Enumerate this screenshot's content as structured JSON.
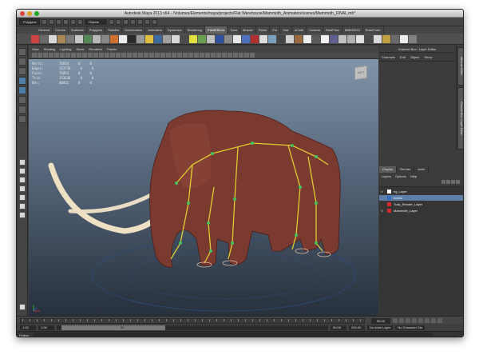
{
  "window": {
    "title": "Autodesk Maya 2013 x64 - /Volumes/Elements/maya/projects/Flat Warehouse/Mammoth_Animation/scenes/Mammoth_FINAL.mb*"
  },
  "statusline": {
    "menuset": "Polygons",
    "selection_field": "Objects"
  },
  "shelf": {
    "tabs": [
      "General",
      "Curves",
      "Surfaces",
      "Polygons",
      "Subdivs",
      "Deformation",
      "Animation",
      "Dynamics",
      "Rendering",
      "PaintEffects",
      "Toon",
      "Muscle",
      "Fluids",
      "Fur",
      "Hair",
      "nCloth",
      "Custom",
      "RealFlow",
      "MMM2013",
      "RoboForm"
    ],
    "active_tab": "PaintEffects",
    "icon_colors": [
      "#c44",
      "#6a6a6a",
      "#d8d8d8",
      "#aa8855",
      "#7a7a7a",
      "#c8c8c8",
      "#558855",
      "#b8b8b8",
      "#888",
      "#d07030",
      "#ececec",
      "#2a2a2a",
      "#999",
      "#e0c040",
      "#3a6aa0",
      "#a0a0a0",
      "#d8d8d8",
      "#4a4a4a",
      "#e0e040",
      "#6aa050",
      "#c0c0c0",
      "#3050a0",
      "#8a8a8a",
      "#e8e8e8",
      "#5070c0",
      "#b03030",
      "#ddd",
      "#7aa0c0",
      "#444",
      "#d0d0d0",
      "#9a6a40",
      "#eeeeee",
      "#5a5a5a",
      "#f0f0f0",
      "#606090",
      "#c0c0c0",
      "#b0b0b0",
      "#e0e0e0",
      "#4a4a4a",
      "#dadada",
      "#c0a040",
      "#6a6a6a",
      "#ececec",
      "#808080"
    ]
  },
  "panel": {
    "menu": [
      "View",
      "Shading",
      "Lighting",
      "Show",
      "Renderer",
      "Panels"
    ]
  },
  "hud": [
    {
      "label": "Verts:",
      "a": "76834",
      "b": "0",
      "c": "0"
    },
    {
      "label": "Edges:",
      "a": "153728",
      "b": "0",
      "c": "0"
    },
    {
      "label": "Faces:",
      "a": "76854",
      "b": "0",
      "c": "0"
    },
    {
      "label": "Tris:",
      "a": "153636",
      "b": "0",
      "c": "0"
    },
    {
      "label": "UVs:",
      "a": "80052",
      "b": "0",
      "c": "0"
    }
  ],
  "viewport": {
    "cube_label": "LEFT"
  },
  "channelbox": {
    "title": "Channel Box / Layer Editor",
    "menu": [
      "Channels",
      "Edit",
      "Object",
      "Show"
    ],
    "side_tabs": [
      "Attribute Editor",
      "Channel Box / Layer Editor"
    ]
  },
  "layers": {
    "tabs": [
      "Display",
      "Render",
      "Anim"
    ],
    "active_tab": "Display",
    "menu": [
      "Layers",
      "Options",
      "Help"
    ],
    "rows": [
      {
        "v": "V",
        "name": "rig_Layer",
        "color": "#ffffff",
        "selected": false
      },
      {
        "v": "",
        "name": "bones",
        "color": "#3a6ec0",
        "selected": true
      },
      {
        "v": "",
        "name": "Tusk_Render_Layer",
        "color": "#d02a2a",
        "selected": false
      },
      {
        "v": "V",
        "name": "Mammoth_Layer",
        "color": "#d02a2a",
        "selected": false
      }
    ]
  },
  "timeslider": {
    "current_frame": "55.00",
    "tick_labels": []
  },
  "range": {
    "start": "1.00",
    "playback_start": "1.00",
    "handle_label": "50",
    "playback_end": "50.00",
    "end": "200.00",
    "anim_layer": "No Anim Layer",
    "character_set": "No Character Set"
  },
  "commandline": {
    "label": "Python"
  }
}
